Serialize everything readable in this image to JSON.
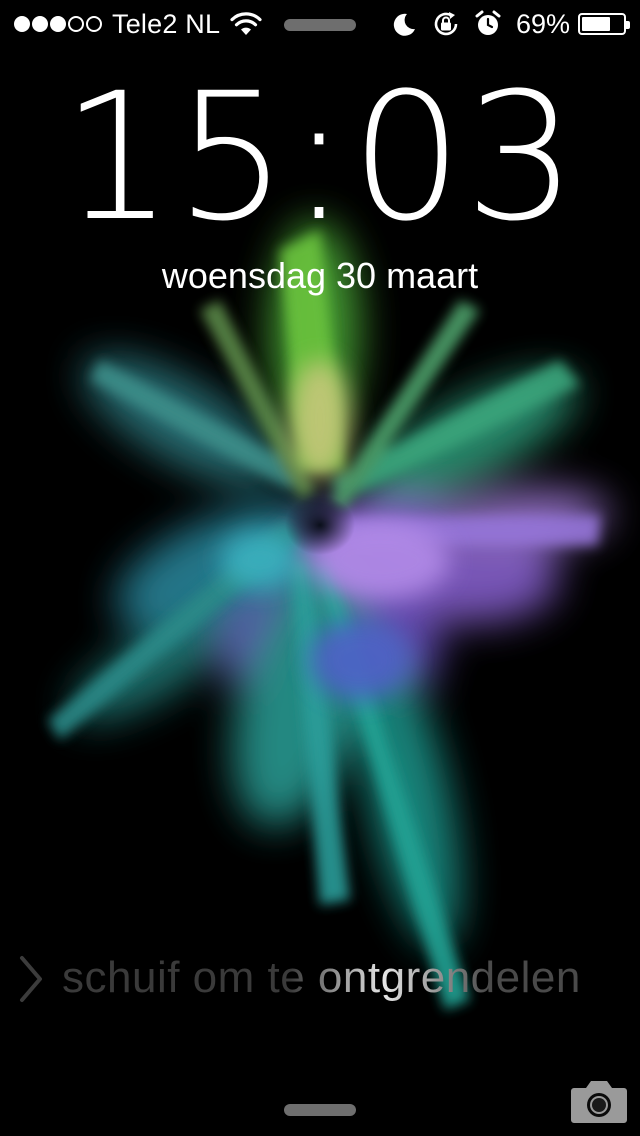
{
  "status_bar": {
    "signal_bars_filled": 3,
    "signal_bars_total": 5,
    "carrier": "Tele2 NL",
    "icons": [
      "wifi-icon",
      "moon-icon",
      "orientation-lock-icon",
      "alarm-icon"
    ],
    "battery_percent_text": "69%",
    "battery_level": 0.69
  },
  "lockscreen": {
    "time": "15:03",
    "date": "woensdag 30 maart",
    "unlock_text": "schuif om te ontgrendelen"
  },
  "colors": {
    "background": "#000000",
    "text": "#ffffff",
    "wallpaper_green": "#5fbf3a",
    "wallpaper_purple": "#9a6be0",
    "wallpaper_teal": "#2aa6a0"
  }
}
